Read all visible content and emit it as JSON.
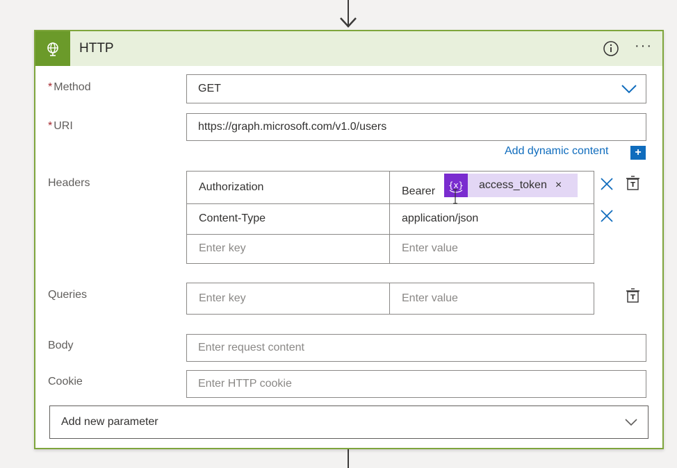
{
  "action": {
    "title": "HTTP",
    "more_label": "···"
  },
  "method": {
    "label": "Method",
    "required_mark": "*",
    "value": "GET"
  },
  "uri": {
    "label": "URI",
    "required_mark": "*",
    "value": "https://graph.microsoft.com/v1.0/users",
    "dynamic_content_label": "Add dynamic content",
    "dynamic_plus": "+"
  },
  "headers": {
    "label": "Headers",
    "rows": [
      {
        "key": "Authorization",
        "value_prefix": "Bearer",
        "token_label": "access_token",
        "token_remove": "×"
      },
      {
        "key": "Content-Type",
        "value": "application/json"
      }
    ],
    "key_placeholder": "Enter key",
    "value_placeholder": "Enter value"
  },
  "queries": {
    "label": "Queries",
    "key_placeholder": "Enter key",
    "value_placeholder": "Enter value"
  },
  "body": {
    "label": "Body",
    "placeholder": "Enter request content"
  },
  "cookie": {
    "label": "Cookie",
    "placeholder": "Enter HTTP cookie"
  },
  "add_parameter": {
    "label": "Add new parameter"
  },
  "colors": {
    "accent_green": "#6b9a2a",
    "header_bg": "#e8f0dc",
    "link_blue": "#0f6cbd",
    "token_purple": "#7a2ccf",
    "token_bg": "#e3d7f5"
  }
}
